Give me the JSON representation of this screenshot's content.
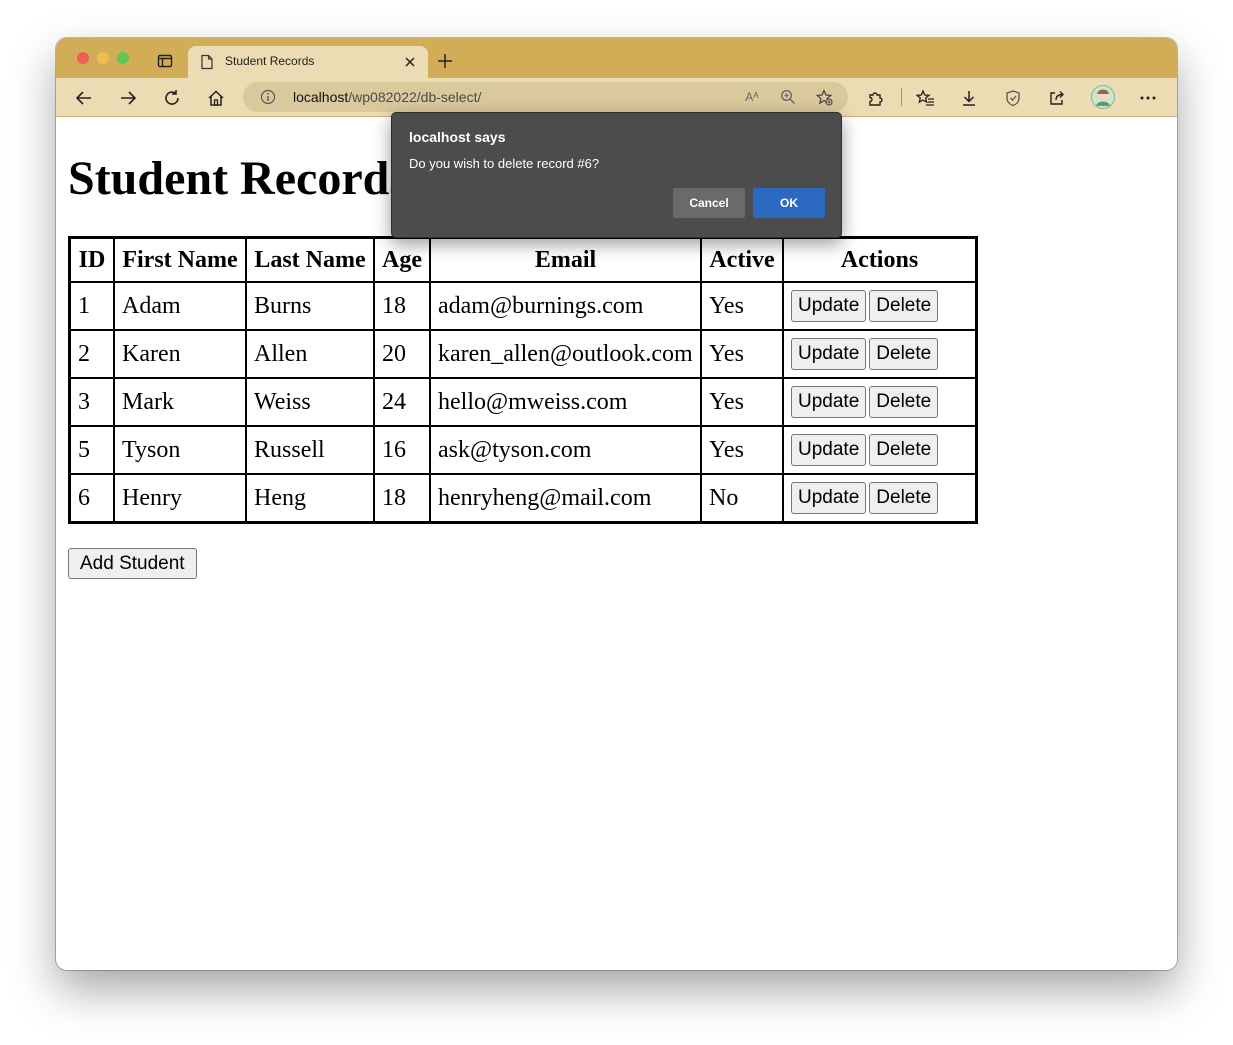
{
  "browser": {
    "tab_title": "Student Records",
    "url_host": "localhost",
    "url_path": "/wp082022/db-select/",
    "read_aloud_label": "Aᴬ"
  },
  "page": {
    "heading": "Student Records",
    "add_button": "Add Student"
  },
  "table": {
    "headers": [
      "ID",
      "First Name",
      "Last Name",
      "Age",
      "Email",
      "Active",
      "Actions"
    ],
    "rows": [
      {
        "id": "1",
        "first": "Adam",
        "last": "Burns",
        "age": "18",
        "email": "adam@burnings.com",
        "active": "Yes"
      },
      {
        "id": "2",
        "first": "Karen",
        "last": "Allen",
        "age": "20",
        "email": "karen_allen@outlook.com",
        "active": "Yes"
      },
      {
        "id": "3",
        "first": "Mark",
        "last": "Weiss",
        "age": "24",
        "email": "hello@mweiss.com",
        "active": "Yes"
      },
      {
        "id": "5",
        "first": "Tyson",
        "last": "Russell",
        "age": "16",
        "email": "ask@tyson.com",
        "active": "Yes"
      },
      {
        "id": "6",
        "first": "Henry",
        "last": "Heng",
        "age": "18",
        "email": "henryheng@mail.com",
        "active": "No"
      }
    ],
    "update_label": "Update",
    "delete_label": "Delete"
  },
  "dialog": {
    "title": "localhost says",
    "message": "Do you wish to delete record #6?",
    "cancel_label": "Cancel",
    "ok_label": "OK"
  },
  "colors": {
    "tabbar": "#d2ad57",
    "toolbar": "#ecdcb3",
    "dialog_bg": "#4c4c4c",
    "ok_button": "#2c69c2"
  }
}
